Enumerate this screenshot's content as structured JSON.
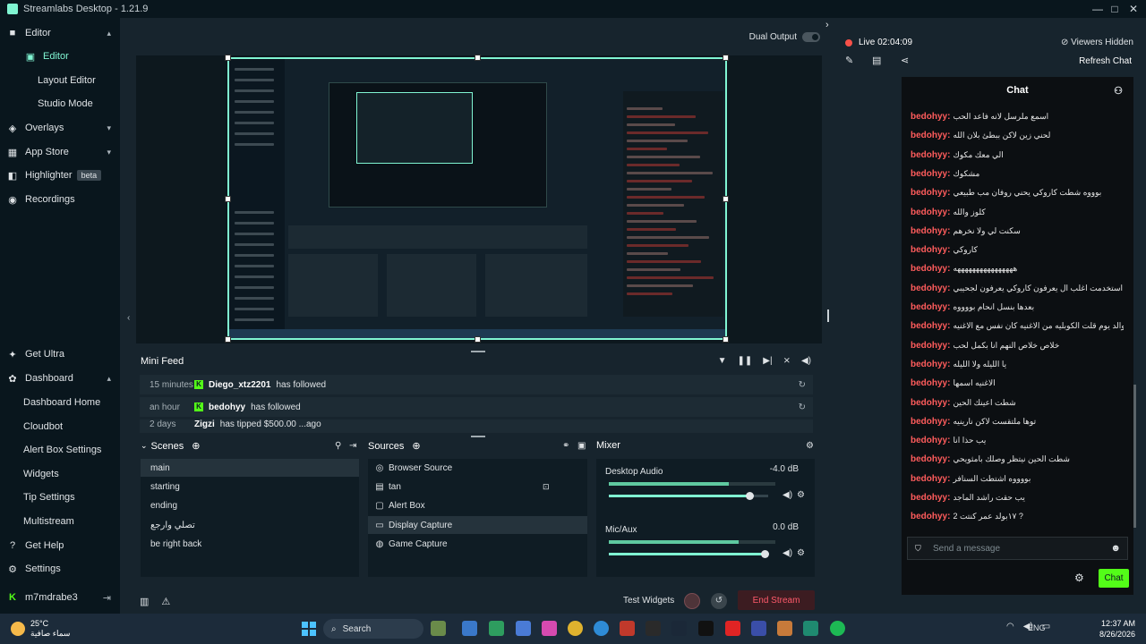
{
  "window": {
    "title": "Streamlabs Desktop - 1.21.9"
  },
  "nav": {
    "items": [
      {
        "label": "Editor",
        "icon": "editor-icon",
        "chevron": "▴"
      },
      {
        "label": "Editor",
        "icon": "editor-sub-icon",
        "active": true
      },
      {
        "label": "Layout Editor"
      },
      {
        "label": "Studio Mode"
      },
      {
        "label": "Overlays",
        "icon": "overlays-icon",
        "chevron": "▾"
      },
      {
        "label": "App Store",
        "icon": "store-icon",
        "chevron": "▾"
      },
      {
        "label": "Highlighter",
        "icon": "highlighter-icon",
        "badge": "beta"
      },
      {
        "label": "Recordings",
        "icon": "recordings-icon"
      }
    ],
    "lower": [
      {
        "label": "Get Ultra",
        "icon": "ultra-icon"
      },
      {
        "label": "Dashboard",
        "icon": "dashboard-icon",
        "chevron": "▴"
      },
      {
        "label": "Dashboard Home"
      },
      {
        "label": "Cloudbot"
      },
      {
        "label": "Alert Box Settings"
      },
      {
        "label": "Widgets"
      },
      {
        "label": "Tip Settings"
      },
      {
        "label": "Multistream"
      },
      {
        "label": "Get Help",
        "icon": "help-icon"
      },
      {
        "label": "Settings",
        "icon": "gear-icon"
      }
    ],
    "user": "m7mdrabe3"
  },
  "editor": {
    "dual_output_label": "Dual Output"
  },
  "minifeed": {
    "title": "Mini Feed",
    "rows": [
      {
        "time": "15 minutes",
        "user": "Diego_xtz2201",
        "event": "has followed"
      },
      {
        "time": "an hour",
        "user": "bedohyy",
        "event": "has followed"
      },
      {
        "time": "2 days",
        "user": "Zigzi",
        "event": "has tipped $500.00 ...ago"
      }
    ]
  },
  "scenes": {
    "title": "Scenes",
    "items": [
      "main",
      "starting",
      "ending",
      "تصلي وارجع",
      "be right back"
    ]
  },
  "sources": {
    "title": "Sources",
    "items": [
      {
        "label": "Browser Source",
        "icon": "globe-icon"
      },
      {
        "label": "tan",
        "icon": "image-icon"
      },
      {
        "label": "Alert Box",
        "icon": "alert-icon"
      },
      {
        "label": "Display Capture",
        "icon": "monitor-icon"
      },
      {
        "label": "Game Capture",
        "icon": "gamepad-icon"
      }
    ]
  },
  "mixer": {
    "title": "Mixer",
    "channels": [
      {
        "name": "Desktop Audio",
        "db": "-4.0 dB",
        "level": 0.72,
        "volume": 0.88
      },
      {
        "name": "Mic/Aux",
        "db": "0.0 dB",
        "level": 0.78,
        "volume": 0.98
      }
    ]
  },
  "footer": {
    "test_widgets": "Test Widgets",
    "end_stream": "End Stream"
  },
  "stream": {
    "live_label": "Live 02:04:09",
    "viewers_label": "Viewers Hidden",
    "refresh_chat": "Refresh Chat"
  },
  "chat": {
    "title": "Chat",
    "messages": [
      {
        "user": "bedohyy:",
        "text": "اسمع ملرسل لانه فاعد الحب"
      },
      {
        "user": "bedohyy:",
        "text": "لحني زين لاكن ببطئ بلان الله"
      },
      {
        "user": "bedohyy:",
        "text": "الي معك مكوك"
      },
      {
        "user": "bedohyy:",
        "text": "مشكوك"
      },
      {
        "user": "bedohyy:",
        "text": "بوووه شطت كاروكي يحني روفان مب طبيعي"
      },
      {
        "user": "bedohyy:",
        "text": "كلوز والله"
      },
      {
        "user": "bedohyy:",
        "text": "سكنت لي ولا نخرهم"
      },
      {
        "user": "bedohyy:",
        "text": "كاروكي"
      },
      {
        "user": "bedohyy:",
        "text": "ههههههههههههههههه"
      },
      {
        "user": "bedohyy:",
        "text": "لاني استخدمت اغلب ال يعرفون كاروكي يعرفون لجحيبي"
      },
      {
        "user": "bedohyy:",
        "text": "بعدها بنسل انحام بووووه"
      },
      {
        "user": "bedohyy:",
        "text": "بوالد يوم قلت الكوبليه من الاغنيه كان نفس مع الاغنيه"
      },
      {
        "user": "bedohyy:",
        "text": "خلاص خلاص النهم انا بكمل لحب"
      },
      {
        "user": "bedohyy:",
        "text": "يا الليله ولا الليله"
      },
      {
        "user": "bedohyy:",
        "text": "الاغنيه اسمها"
      },
      {
        "user": "bedohyy:",
        "text": "شطت اعينك الحين"
      },
      {
        "user": "bedohyy:",
        "text": "توها ملتقست لاكن نارينيه"
      },
      {
        "user": "bedohyy:",
        "text": "يب حذا انا"
      },
      {
        "user": "bedohyy:",
        "text": "شطت الحين نيتظر وصلك بامثويحي"
      },
      {
        "user": "bedohyy:",
        "text": "بووووه اشتطت السنافر"
      },
      {
        "user": "bedohyy:",
        "text": "يب حقت راشد الماجد"
      },
      {
        "user": "bedohyy:",
        "text": "١٧بولد عمر كنتت 2 ?"
      }
    ],
    "placeholder": "Send a message",
    "send_label": "Chat"
  },
  "taskbar": {
    "weather_temp": "25°C",
    "weather_desc": "سماء صافية",
    "search": "Search",
    "lang": "ENG",
    "time": "12:37 AM",
    "date": "8/26/2026"
  },
  "colors": {
    "accent": "#80f5d2",
    "kick_green": "#53fc18",
    "chat_user": "#ff5c5c",
    "live_red": "#f85149"
  }
}
